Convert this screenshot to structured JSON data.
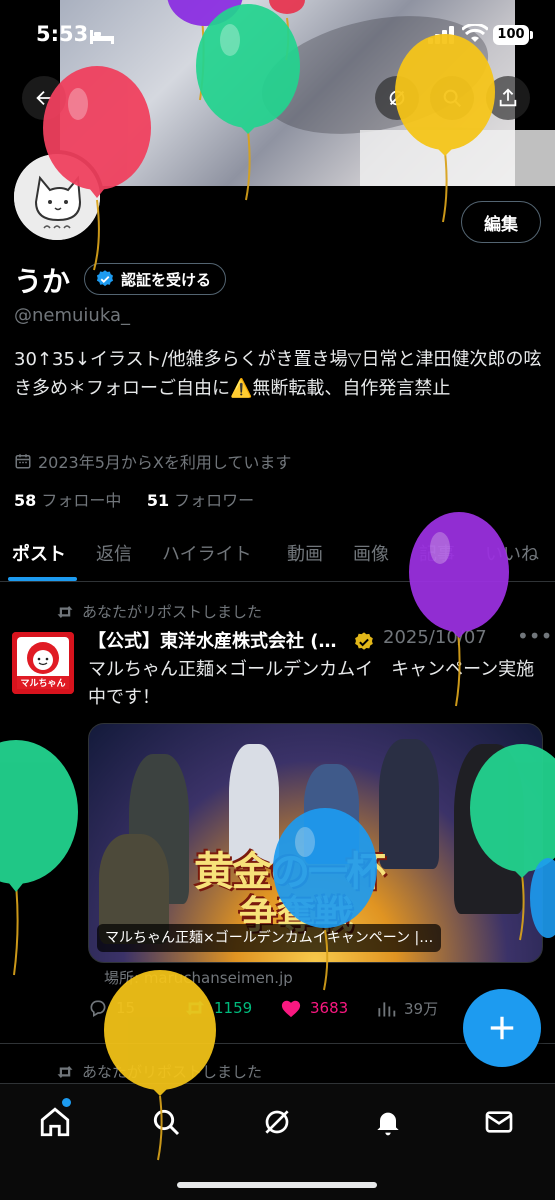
{
  "status_bar": {
    "time": "5:53",
    "battery": "100"
  },
  "profile": {
    "name": "うか",
    "verify_label": "認証を受ける",
    "handle": "@nemuiuka_",
    "edit_label": "編集",
    "bio": "30↑35↓イラスト/他雑多らくがき置き場▽日常と津田健次郎の呟き多め＊フォローご自由に⚠️無断転載、自作発言禁止",
    "joined": "2023年5月からXを利用しています",
    "following_count": "58",
    "following_label": "フォロー中",
    "followers_count": "51",
    "followers_label": "フォロワー"
  },
  "tabs": [
    "ポスト",
    "返信",
    "ハイライト",
    "動画",
    "画像",
    "記事",
    "いいね"
  ],
  "post": {
    "repost_label": "あなたがリポストしました",
    "author": "【公式】東洋水産株式会社 (…",
    "date": "2025/10/07",
    "avatar_text": "マルちゃん",
    "text": "マルちゃん正麺×ゴールデンカムイ　キャンペーン実施中です！",
    "card_title_line1": "黄金の一杯",
    "card_title_line2": "争奪戦",
    "card_caption": "マルちゃん正麺×ゴールデンカムイキャンペーン |…",
    "source": "場所: maruchanseimen.jp",
    "replies": "15",
    "reposts": "1159",
    "likes": "3683",
    "views": "39万"
  },
  "next_post": {
    "repost_label": "あなたがリポストしました"
  },
  "colors": {
    "accent": "#1d9bf0",
    "repost_green": "#00ba7c",
    "like_pink": "#f91880",
    "muted": "#71767b"
  },
  "icons": {
    "back": "back-arrow-icon",
    "grok": "grok-icon",
    "search": "search-icon",
    "share": "share-icon",
    "nav": [
      "home-icon",
      "search-icon",
      "grok-icon",
      "bell-icon",
      "mail-icon"
    ]
  }
}
